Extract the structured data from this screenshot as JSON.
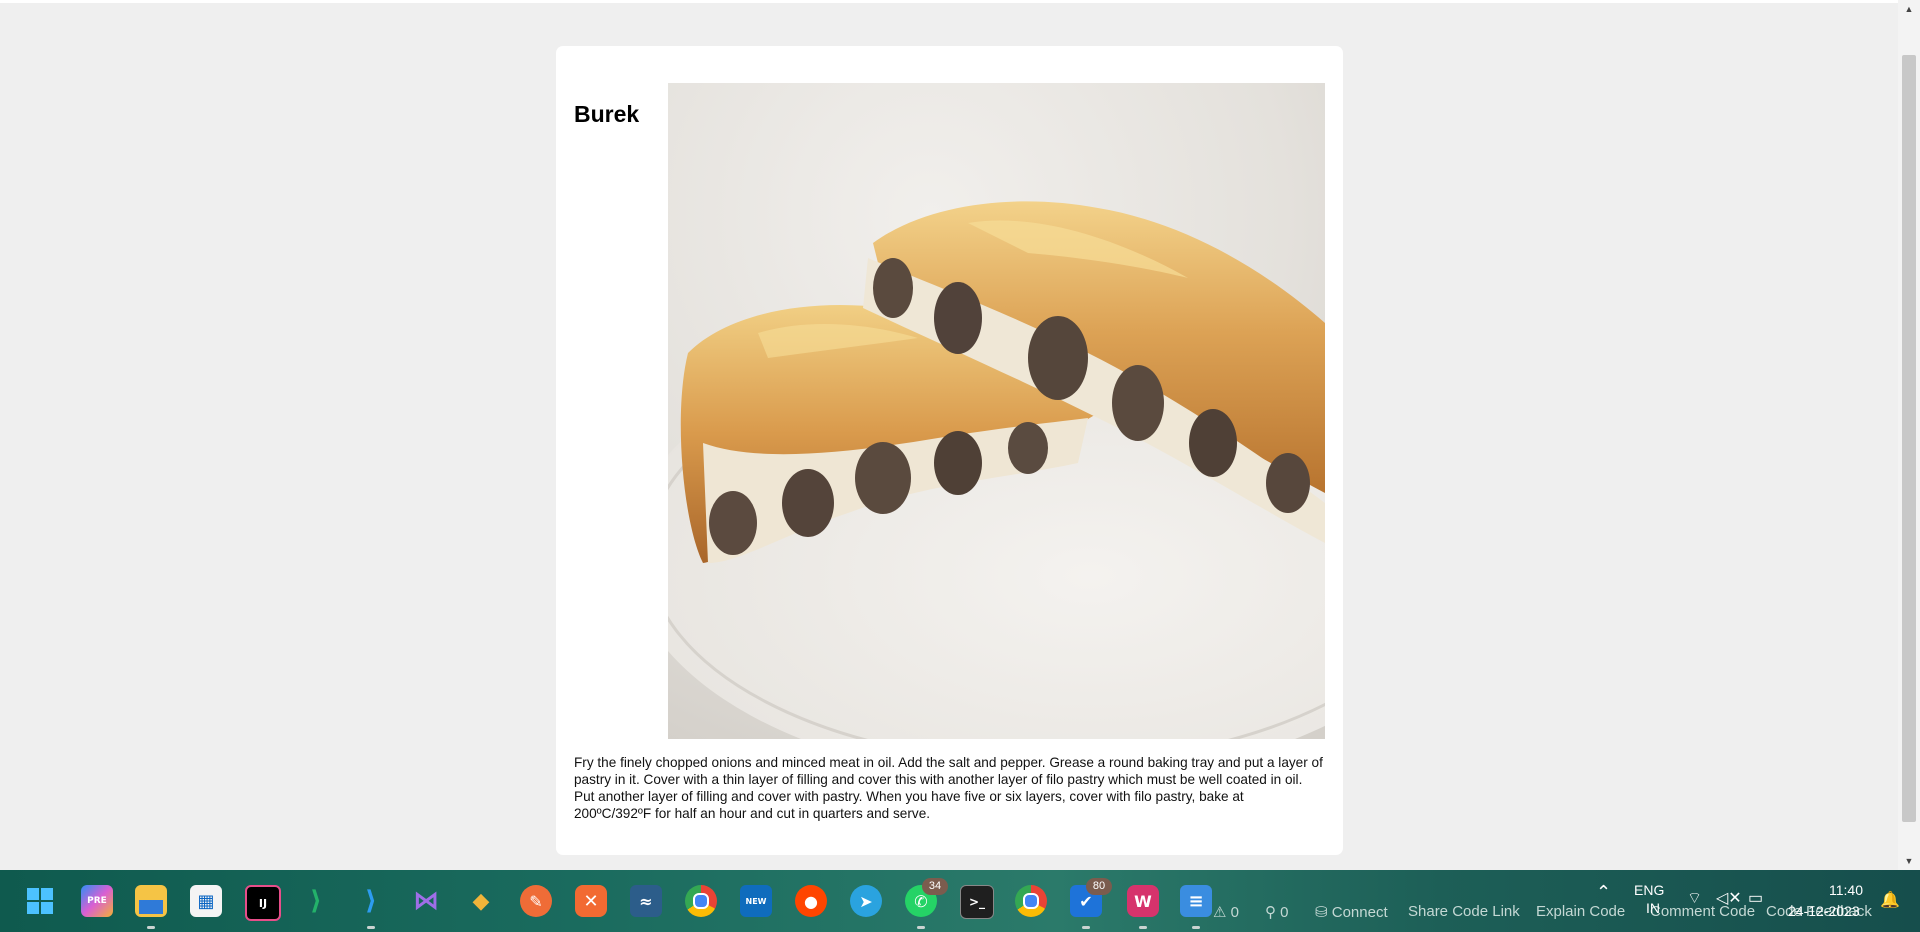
{
  "recipe": {
    "title": "Burek",
    "image_alt": "Burek",
    "description": "Fry the finely chopped onions and minced meat in oil. Add the salt and pepper. Grease a round baking tray and put a layer of pastry in it. Cover with a thin layer of filling and cover this with another layer of filo pastry which must be well coated in oil. Put another layer of filling and cover with pastry. When you have five or six layers, cover with filo pastry, bake at 200ºC/392ºF for half an hour and cut in quarters and serve."
  },
  "taskbar": {
    "apps": [
      {
        "name": "start-icon"
      },
      {
        "name": "copilot-pre-icon",
        "label": "PRE"
      },
      {
        "name": "file-explorer-icon"
      },
      {
        "name": "microsoft-store-icon"
      },
      {
        "name": "intellij-icon",
        "label": "IJ"
      },
      {
        "name": "vscode-green-icon"
      },
      {
        "name": "vscode-icon"
      },
      {
        "name": "visual-studio-icon"
      },
      {
        "name": "git-icon"
      },
      {
        "name": "postman-icon"
      },
      {
        "name": "xampp-icon"
      },
      {
        "name": "mysql-workbench-icon"
      },
      {
        "name": "chrome-icon"
      },
      {
        "name": "outlook-new-icon",
        "label": "NEW"
      },
      {
        "name": "reddit-icon"
      },
      {
        "name": "telegram-icon"
      },
      {
        "name": "whatsapp-icon",
        "badge": "34"
      },
      {
        "name": "terminal-icon"
      },
      {
        "name": "chrome-profile-icon"
      },
      {
        "name": "todo-icon",
        "badge": "80"
      },
      {
        "name": "wps-icon"
      },
      {
        "name": "notepad-icon"
      }
    ],
    "status": {
      "warnings": "0",
      "ports": "0",
      "connect": "Connect",
      "share_code_link": "Share Code Link",
      "explain_code": "Explain Code",
      "comment_code": "Comment Code",
      "code_feedback": "Code Feedback"
    },
    "tray": {
      "language_line1": "ENG",
      "language_line2": "IN",
      "time": "11:40",
      "date": "24-12-2023"
    }
  }
}
